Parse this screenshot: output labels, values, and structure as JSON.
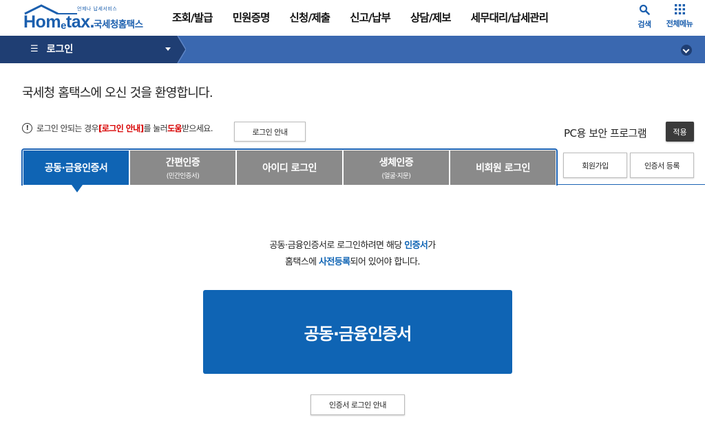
{
  "header": {
    "logo_sub": "언제나 납세서비스",
    "logo_main_pre": "Hom",
    "logo_main_e": "e",
    "logo_main_post": "tax.",
    "logo_kr": "국세청홈택스",
    "nav": [
      "조회/발급",
      "민원증명",
      "신청/제출",
      "신고/납부",
      "상담/제보",
      "세무대리/납세관리"
    ],
    "search_label": "검색",
    "all_menu_label": "전체메뉴"
  },
  "bar": {
    "menu_label": "로그인"
  },
  "content": {
    "welcome": "국세청 홈택스에 오신 것을 환영합니다.",
    "notice_pre": "로그인 안되는 경우 ",
    "notice_red1": "[로그인 안내]",
    "notice_mid": "를 눌러 ",
    "notice_red2": "도움",
    "notice_post": "받으세요.",
    "login_guide_button": "로그인 안내",
    "pc_security": "PC용 보안 프로그램",
    "apply_button": "적용"
  },
  "tabs": [
    {
      "label": "공동·금융인증서",
      "sub": ""
    },
    {
      "label": "간편인증",
      "sub": "(민간인증서)"
    },
    {
      "label": "아이디 로그인",
      "sub": ""
    },
    {
      "label": "생체인증",
      "sub": "(얼굴·지문)"
    },
    {
      "label": "비회원 로그인",
      "sub": ""
    }
  ],
  "side_buttons": {
    "signup": "회원가입",
    "cert_register": "인증서 등록"
  },
  "panel": {
    "line1_pre": "공동·금융인증서로 로그인하려면 해당 ",
    "line1_blue": "인증서",
    "line1_post": "가",
    "line2_pre": "홈택스에 ",
    "line2_blue": "사전등록",
    "line2_post": "되어 있어야 합니다.",
    "big_button": "공동·금융인증서",
    "cert_login_guide": "인증서 로그인 안내"
  },
  "colors": {
    "brand_blue": "#0f64b4",
    "bar_blue": "#3a68b0",
    "bar_dark": "#1f3e73",
    "tab_gray": "#8a8a8a",
    "alert_red": "#d80000"
  }
}
